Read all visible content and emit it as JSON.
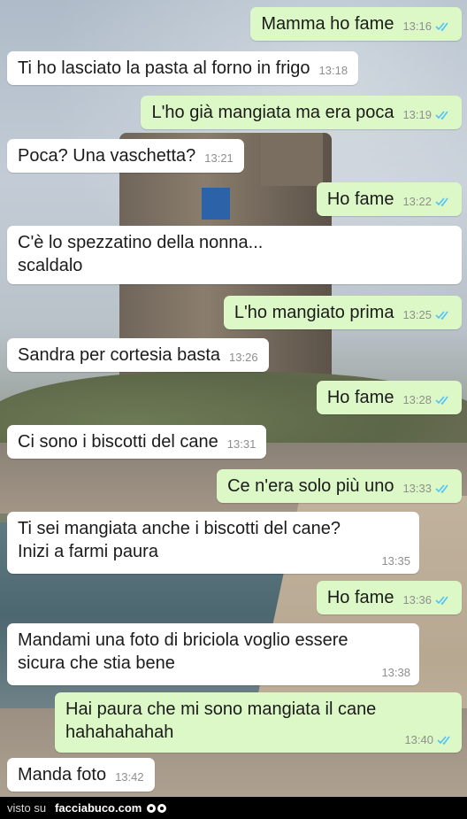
{
  "messages": [
    {
      "dir": "out",
      "text": "Mamma ho fame",
      "time": "13:16",
      "read": true
    },
    {
      "dir": "in",
      "text": "Ti ho lasciato la pasta al forno in frigo",
      "time": "13:18"
    },
    {
      "dir": "out",
      "text": "L'ho già mangiata ma era poca",
      "time": "13:19",
      "read": true
    },
    {
      "dir": "in",
      "text": "Poca? Una vaschetta?",
      "time": "13:21"
    },
    {
      "dir": "out",
      "text": "Ho fame",
      "time": "13:22",
      "read": true
    },
    {
      "dir": "in",
      "text": "C'è lo spezzatino della nonna...\nscaldalo",
      "time": ""
    },
    {
      "dir": "out",
      "text": "L'ho mangiato prima",
      "time": "13:25",
      "read": true
    },
    {
      "dir": "in",
      "text": "Sandra per cortesia basta",
      "time": "13:26"
    },
    {
      "dir": "out",
      "text": "Ho fame",
      "time": "13:28",
      "read": true
    },
    {
      "dir": "in",
      "text": "Ci sono i biscotti del cane",
      "time": "13:31"
    },
    {
      "dir": "out",
      "text": "Ce n'era solo più uno",
      "time": "13:33",
      "read": true
    },
    {
      "dir": "in",
      "text": "Ti sei mangiata anche i biscotti del cane?\nInizi a farmi paura",
      "time": "13:35"
    },
    {
      "dir": "out",
      "text": "Ho fame",
      "time": "13:36",
      "read": true
    },
    {
      "dir": "in",
      "text": "Mandami una foto di briciola voglio essere\nsicura che stia bene",
      "time": "13:38"
    },
    {
      "dir": "out",
      "text": "Hai paura che mi sono mangiata il cane\nhahahahahah",
      "time": "13:40",
      "read": true
    },
    {
      "dir": "in",
      "text": "Manda foto",
      "time": "13:42"
    }
  ],
  "footer": {
    "prefix": "visto su",
    "site": "facciabuco.com"
  },
  "colors": {
    "outgoing": "#dcf8c6",
    "incoming": "#ffffff",
    "read_ticks": "#4fc3f7"
  }
}
